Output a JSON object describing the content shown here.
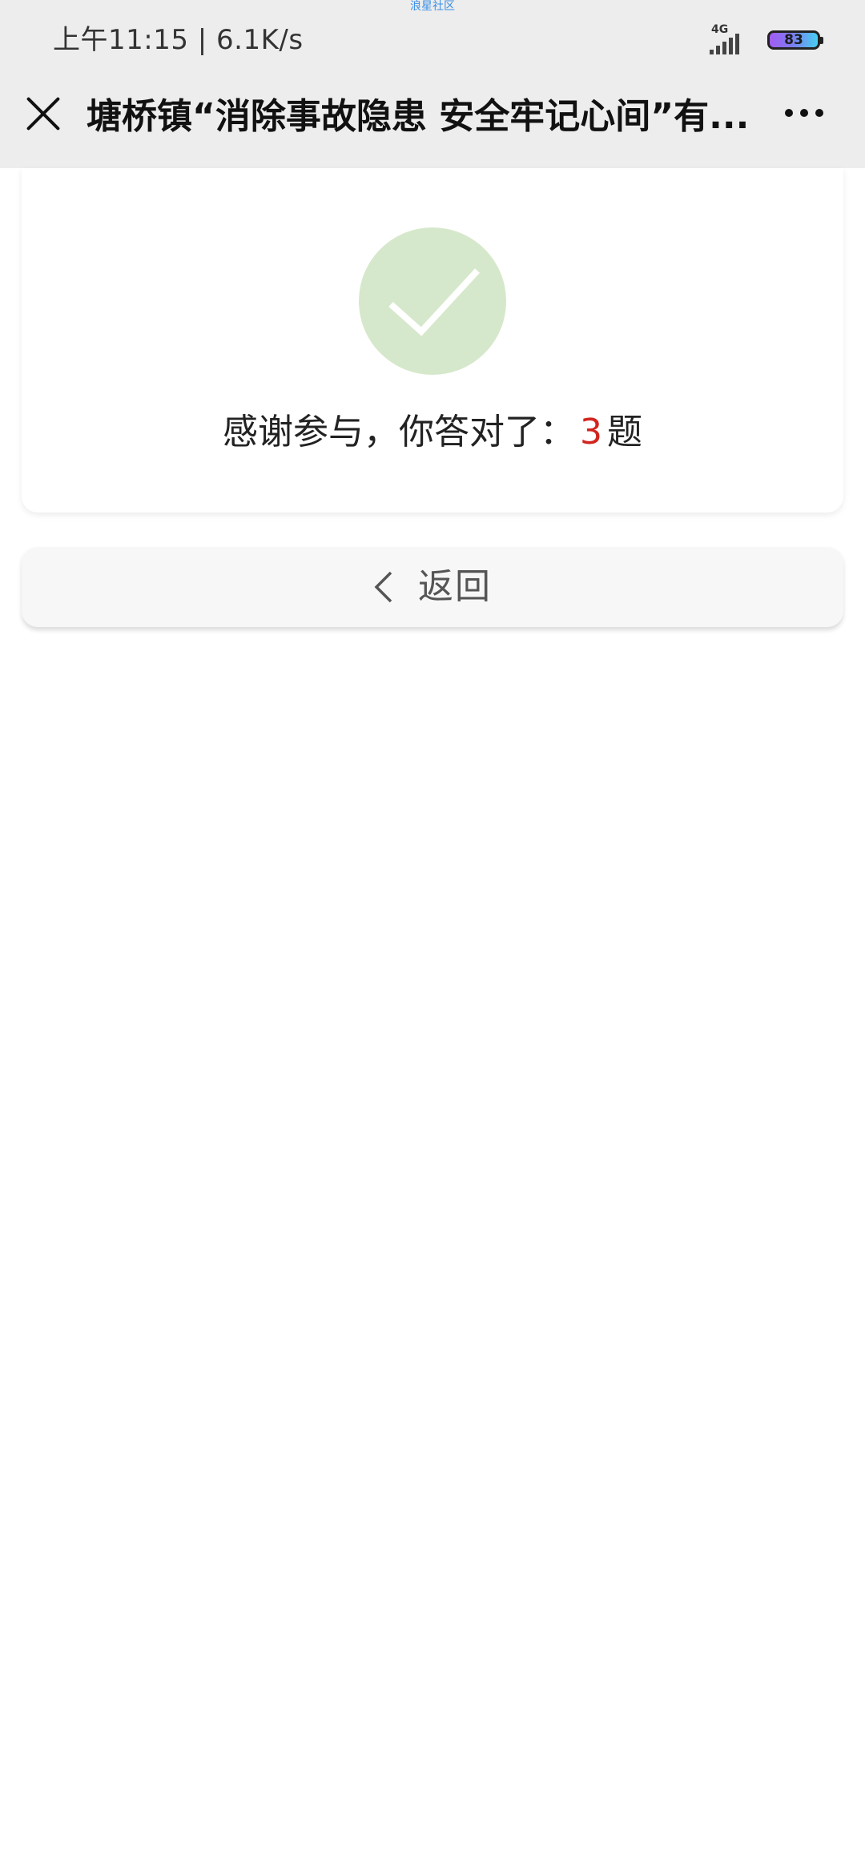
{
  "watermark": "浪星社区",
  "status_bar": {
    "time_speed": "上午11:15 | 6.1K/s",
    "network": "4G",
    "battery": "83",
    "battery_color": "#7d7af0"
  },
  "nav": {
    "title": "塘桥镇“消除事故隐患 安全牢记心间”有...",
    "close_icon": "close-icon",
    "more_icon": "more-dots-icon"
  },
  "result": {
    "message_prefix": "感谢参与，你答对了：",
    "correct_count": "3",
    "message_suffix": "题",
    "check_icon": "checkmark-icon",
    "check_color": "#d6e8cb",
    "count_color": "#d2251f"
  },
  "back": {
    "label": "返回",
    "icon": "chevron-left-icon"
  }
}
